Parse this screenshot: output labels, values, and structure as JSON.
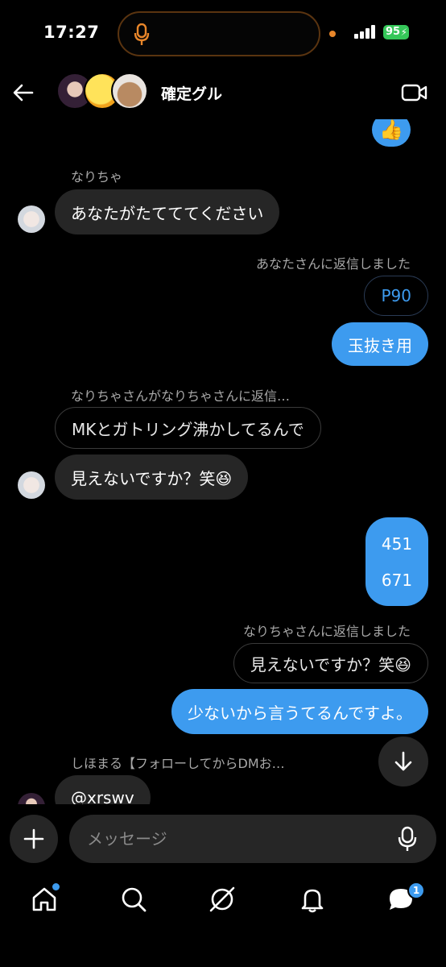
{
  "status_bar": {
    "time": "17:27",
    "battery": "95"
  },
  "header": {
    "title": "確定グル"
  },
  "messages": {
    "reaction": "👍",
    "m1_sender": "なりちゃ",
    "m1_text": "あなたがたてててください",
    "m2_reply_label": "あなたさんに返信しました",
    "m2_quote": "P90",
    "m2_text": "玉抜き用",
    "m3_reply_label": "なりちゃさんがなりちゃさんに返信…",
    "m3_quote": "MKとガトリング沸かしてるんで",
    "m3_text": "見えないですか？笑😆",
    "m4_line1": "451",
    "m4_line2": "671",
    "m5_reply_label": "なりちゃさんに返信しました",
    "m5_quote": "見えないですか？笑😆",
    "m5_text": "少ないから言うてるんですよ。",
    "m6_sender": "しほまる【フォローしてからDMお…",
    "m6_text": "@xrswv"
  },
  "composer": {
    "placeholder": "メッセージ"
  },
  "tabbar": {
    "messages_badge": "1"
  },
  "colors": {
    "accent": "#3d9bef",
    "incoming_bubble": "#262626",
    "background": "#000000"
  }
}
